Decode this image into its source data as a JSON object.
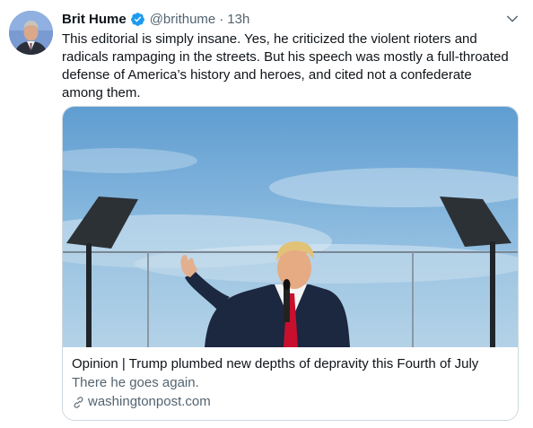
{
  "author": {
    "display_name": "Brit Hume",
    "handle": "@brithume",
    "time": "13h"
  },
  "separator": "·",
  "tweet": {
    "text": "This editorial is simply insane. Yes, he criticized the violent rioters and radicals rampaging in the streets. But his speech was mostly a full-throated defense of America’s history and heroes, and cited not a confederate among them."
  },
  "card": {
    "title": "Opinion | Trump plumbed new depths of depravity this Fourth of July",
    "description": "There he goes again.",
    "domain": "washingtonpost.com"
  },
  "icons": {
    "verified": "verified-badge-icon",
    "caret": "chevron-down-icon",
    "link": "link-icon"
  },
  "colors": {
    "text": "#0f1419",
    "secondary": "#536471",
    "verified": "#1d9bf0",
    "border": "#cfd9de"
  }
}
